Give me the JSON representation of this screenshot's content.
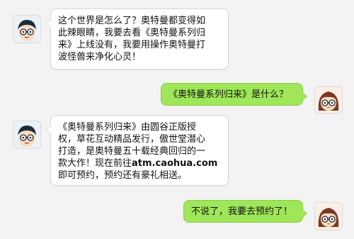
{
  "colors": {
    "background": "#f3f3f3",
    "incoming_bubble": "#ffffff",
    "outgoing_bubble": "#9fe658"
  },
  "avatars": {
    "incoming": "boy-with-glasses-avatar",
    "outgoing": "girl-with-glasses-avatar"
  },
  "messages": [
    {
      "side": "left",
      "lines": [
        "这个世界是怎么了？奥特曼都变得如",
        "此辣眼睛，我要去看《奥特曼系列归",
        "来》上线没有，我要用操作奥特曼打",
        "波怪兽来净化心灵！"
      ]
    },
    {
      "side": "right",
      "lines": [
        "《奥特曼系列归来》是什么？"
      ]
    },
    {
      "side": "left",
      "lines": [
        "《奥特曼系列归来》由圆谷正版授",
        "权，草花互动精品发行，傲世堂潜心",
        "打造，是奥特曼五十载经典回归的一",
        "款大作！现在前往"
      ],
      "link_text": "atm.caohua.com",
      "after_link": "即可预约，预约还有豪礼相送。"
    },
    {
      "side": "right",
      "lines": [
        "不说了，我要去预约了！"
      ]
    }
  ]
}
